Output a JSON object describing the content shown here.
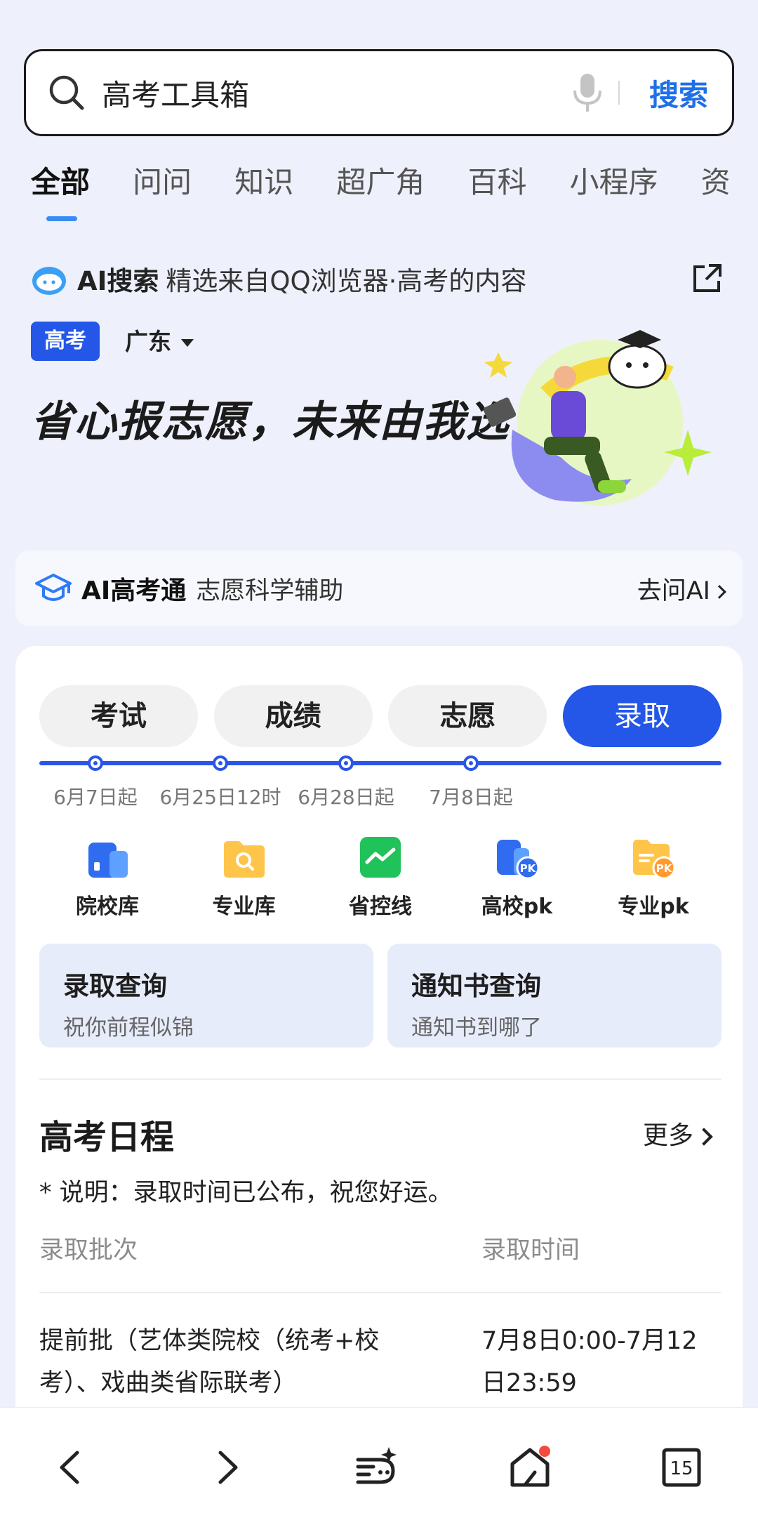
{
  "search": {
    "query": "高考工具箱",
    "button_label": "搜索"
  },
  "tabs": [
    {
      "label": "全部",
      "active": true
    },
    {
      "label": "问问"
    },
    {
      "label": "知识"
    },
    {
      "label": "超广角"
    },
    {
      "label": "百科"
    },
    {
      "label": "小程序"
    },
    {
      "label": "资"
    }
  ],
  "ai_source": {
    "label": "AI搜索",
    "text": "精选来自QQ浏览器·高考的内容"
  },
  "hero": {
    "badge": "高考",
    "region": "广东",
    "slogan": "省心报志愿，未来由我选"
  },
  "ai_strip": {
    "title": "AI高考通",
    "subtitle": "志愿科学辅助",
    "action": "去问AI"
  },
  "stages": [
    {
      "label": "考试",
      "date": "6月7日起"
    },
    {
      "label": "成绩",
      "date": "6月25日12时"
    },
    {
      "label": "志愿",
      "date": "6月28日起"
    },
    {
      "label": "录取",
      "date": "7月8日起",
      "active": true
    }
  ],
  "tools": [
    {
      "label": "院校库",
      "icon": "building-icon"
    },
    {
      "label": "专业库",
      "icon": "folder-search-icon"
    },
    {
      "label": "省控线",
      "icon": "trend-chart-icon"
    },
    {
      "label": "高校pk",
      "icon": "building-pk-icon"
    },
    {
      "label": "专业pk",
      "icon": "folder-pk-icon"
    }
  ],
  "queries": [
    {
      "title": "录取查询",
      "subtitle": "祝你前程似锦"
    },
    {
      "title": "通知书查询",
      "subtitle": "通知书到哪了"
    }
  ],
  "schedule": {
    "title": "高考日程",
    "more": "更多",
    "note": "* 说明：录取时间已公布，祝您好运。",
    "col_batch": "录取批次",
    "col_time": "录取时间",
    "rows": [
      {
        "batch": "提前批（艺体类院校（统考+校考）、戏曲类省际联考）",
        "time": "7月8日0:00-7月12日23:59"
      }
    ]
  },
  "bottom_nav": {
    "tabs_count": "15"
  },
  "colors": {
    "accent": "#2457e8",
    "link": "#1f6fe8",
    "page_bg": "#eef0fb",
    "query_card_bg": "#e7ecfb"
  }
}
